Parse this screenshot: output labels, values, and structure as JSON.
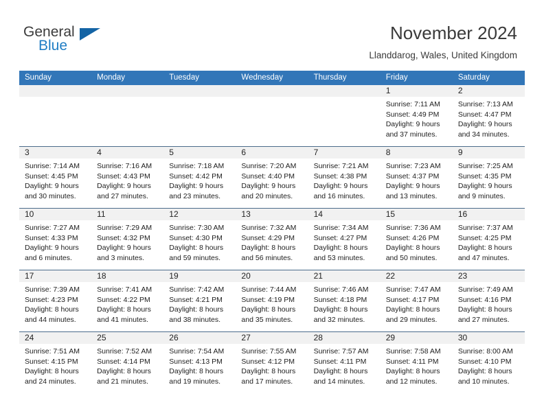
{
  "brand": {
    "name_top": "General",
    "name_bottom": "Blue",
    "accent_color": "#1464a5",
    "text_color": "#3b3b3b"
  },
  "header": {
    "title": "November 2024",
    "subtitle": "Llanddarog, Wales, United Kingdom",
    "header_bg": "#3276b8",
    "header_text": "#ffffff"
  },
  "weekdays": [
    "Sunday",
    "Monday",
    "Tuesday",
    "Wednesday",
    "Thursday",
    "Friday",
    "Saturday"
  ],
  "weeks": [
    [
      {
        "day": "",
        "sunrise": "",
        "sunset": "",
        "daylight": "",
        "empty": true
      },
      {
        "day": "",
        "sunrise": "",
        "sunset": "",
        "daylight": "",
        "empty": true
      },
      {
        "day": "",
        "sunrise": "",
        "sunset": "",
        "daylight": "",
        "empty": true
      },
      {
        "day": "",
        "sunrise": "",
        "sunset": "",
        "daylight": "",
        "empty": true
      },
      {
        "day": "",
        "sunrise": "",
        "sunset": "",
        "daylight": "",
        "empty": true
      },
      {
        "day": "1",
        "sunrise": "Sunrise: 7:11 AM",
        "sunset": "Sunset: 4:49 PM",
        "daylight": "Daylight: 9 hours and 37 minutes.",
        "empty": false
      },
      {
        "day": "2",
        "sunrise": "Sunrise: 7:13 AM",
        "sunset": "Sunset: 4:47 PM",
        "daylight": "Daylight: 9 hours and 34 minutes.",
        "empty": false
      }
    ],
    [
      {
        "day": "3",
        "sunrise": "Sunrise: 7:14 AM",
        "sunset": "Sunset: 4:45 PM",
        "daylight": "Daylight: 9 hours and 30 minutes.",
        "empty": false
      },
      {
        "day": "4",
        "sunrise": "Sunrise: 7:16 AM",
        "sunset": "Sunset: 4:43 PM",
        "daylight": "Daylight: 9 hours and 27 minutes.",
        "empty": false
      },
      {
        "day": "5",
        "sunrise": "Sunrise: 7:18 AM",
        "sunset": "Sunset: 4:42 PM",
        "daylight": "Daylight: 9 hours and 23 minutes.",
        "empty": false
      },
      {
        "day": "6",
        "sunrise": "Sunrise: 7:20 AM",
        "sunset": "Sunset: 4:40 PM",
        "daylight": "Daylight: 9 hours and 20 minutes.",
        "empty": false
      },
      {
        "day": "7",
        "sunrise": "Sunrise: 7:21 AM",
        "sunset": "Sunset: 4:38 PM",
        "daylight": "Daylight: 9 hours and 16 minutes.",
        "empty": false
      },
      {
        "day": "8",
        "sunrise": "Sunrise: 7:23 AM",
        "sunset": "Sunset: 4:37 PM",
        "daylight": "Daylight: 9 hours and 13 minutes.",
        "empty": false
      },
      {
        "day": "9",
        "sunrise": "Sunrise: 7:25 AM",
        "sunset": "Sunset: 4:35 PM",
        "daylight": "Daylight: 9 hours and 9 minutes.",
        "empty": false
      }
    ],
    [
      {
        "day": "10",
        "sunrise": "Sunrise: 7:27 AM",
        "sunset": "Sunset: 4:33 PM",
        "daylight": "Daylight: 9 hours and 6 minutes.",
        "empty": false
      },
      {
        "day": "11",
        "sunrise": "Sunrise: 7:29 AM",
        "sunset": "Sunset: 4:32 PM",
        "daylight": "Daylight: 9 hours and 3 minutes.",
        "empty": false
      },
      {
        "day": "12",
        "sunrise": "Sunrise: 7:30 AM",
        "sunset": "Sunset: 4:30 PM",
        "daylight": "Daylight: 8 hours and 59 minutes.",
        "empty": false
      },
      {
        "day": "13",
        "sunrise": "Sunrise: 7:32 AM",
        "sunset": "Sunset: 4:29 PM",
        "daylight": "Daylight: 8 hours and 56 minutes.",
        "empty": false
      },
      {
        "day": "14",
        "sunrise": "Sunrise: 7:34 AM",
        "sunset": "Sunset: 4:27 PM",
        "daylight": "Daylight: 8 hours and 53 minutes.",
        "empty": false
      },
      {
        "day": "15",
        "sunrise": "Sunrise: 7:36 AM",
        "sunset": "Sunset: 4:26 PM",
        "daylight": "Daylight: 8 hours and 50 minutes.",
        "empty": false
      },
      {
        "day": "16",
        "sunrise": "Sunrise: 7:37 AM",
        "sunset": "Sunset: 4:25 PM",
        "daylight": "Daylight: 8 hours and 47 minutes.",
        "empty": false
      }
    ],
    [
      {
        "day": "17",
        "sunrise": "Sunrise: 7:39 AM",
        "sunset": "Sunset: 4:23 PM",
        "daylight": "Daylight: 8 hours and 44 minutes.",
        "empty": false
      },
      {
        "day": "18",
        "sunrise": "Sunrise: 7:41 AM",
        "sunset": "Sunset: 4:22 PM",
        "daylight": "Daylight: 8 hours and 41 minutes.",
        "empty": false
      },
      {
        "day": "19",
        "sunrise": "Sunrise: 7:42 AM",
        "sunset": "Sunset: 4:21 PM",
        "daylight": "Daylight: 8 hours and 38 minutes.",
        "empty": false
      },
      {
        "day": "20",
        "sunrise": "Sunrise: 7:44 AM",
        "sunset": "Sunset: 4:19 PM",
        "daylight": "Daylight: 8 hours and 35 minutes.",
        "empty": false
      },
      {
        "day": "21",
        "sunrise": "Sunrise: 7:46 AM",
        "sunset": "Sunset: 4:18 PM",
        "daylight": "Daylight: 8 hours and 32 minutes.",
        "empty": false
      },
      {
        "day": "22",
        "sunrise": "Sunrise: 7:47 AM",
        "sunset": "Sunset: 4:17 PM",
        "daylight": "Daylight: 8 hours and 29 minutes.",
        "empty": false
      },
      {
        "day": "23",
        "sunrise": "Sunrise: 7:49 AM",
        "sunset": "Sunset: 4:16 PM",
        "daylight": "Daylight: 8 hours and 27 minutes.",
        "empty": false
      }
    ],
    [
      {
        "day": "24",
        "sunrise": "Sunrise: 7:51 AM",
        "sunset": "Sunset: 4:15 PM",
        "daylight": "Daylight: 8 hours and 24 minutes.",
        "empty": false
      },
      {
        "day": "25",
        "sunrise": "Sunrise: 7:52 AM",
        "sunset": "Sunset: 4:14 PM",
        "daylight": "Daylight: 8 hours and 21 minutes.",
        "empty": false
      },
      {
        "day": "26",
        "sunrise": "Sunrise: 7:54 AM",
        "sunset": "Sunset: 4:13 PM",
        "daylight": "Daylight: 8 hours and 19 minutes.",
        "empty": false
      },
      {
        "day": "27",
        "sunrise": "Sunrise: 7:55 AM",
        "sunset": "Sunset: 4:12 PM",
        "daylight": "Daylight: 8 hours and 17 minutes.",
        "empty": false
      },
      {
        "day": "28",
        "sunrise": "Sunrise: 7:57 AM",
        "sunset": "Sunset: 4:11 PM",
        "daylight": "Daylight: 8 hours and 14 minutes.",
        "empty": false
      },
      {
        "day": "29",
        "sunrise": "Sunrise: 7:58 AM",
        "sunset": "Sunset: 4:11 PM",
        "daylight": "Daylight: 8 hours and 12 minutes.",
        "empty": false
      },
      {
        "day": "30",
        "sunrise": "Sunrise: 8:00 AM",
        "sunset": "Sunset: 4:10 PM",
        "daylight": "Daylight: 8 hours and 10 minutes.",
        "empty": false
      }
    ]
  ]
}
